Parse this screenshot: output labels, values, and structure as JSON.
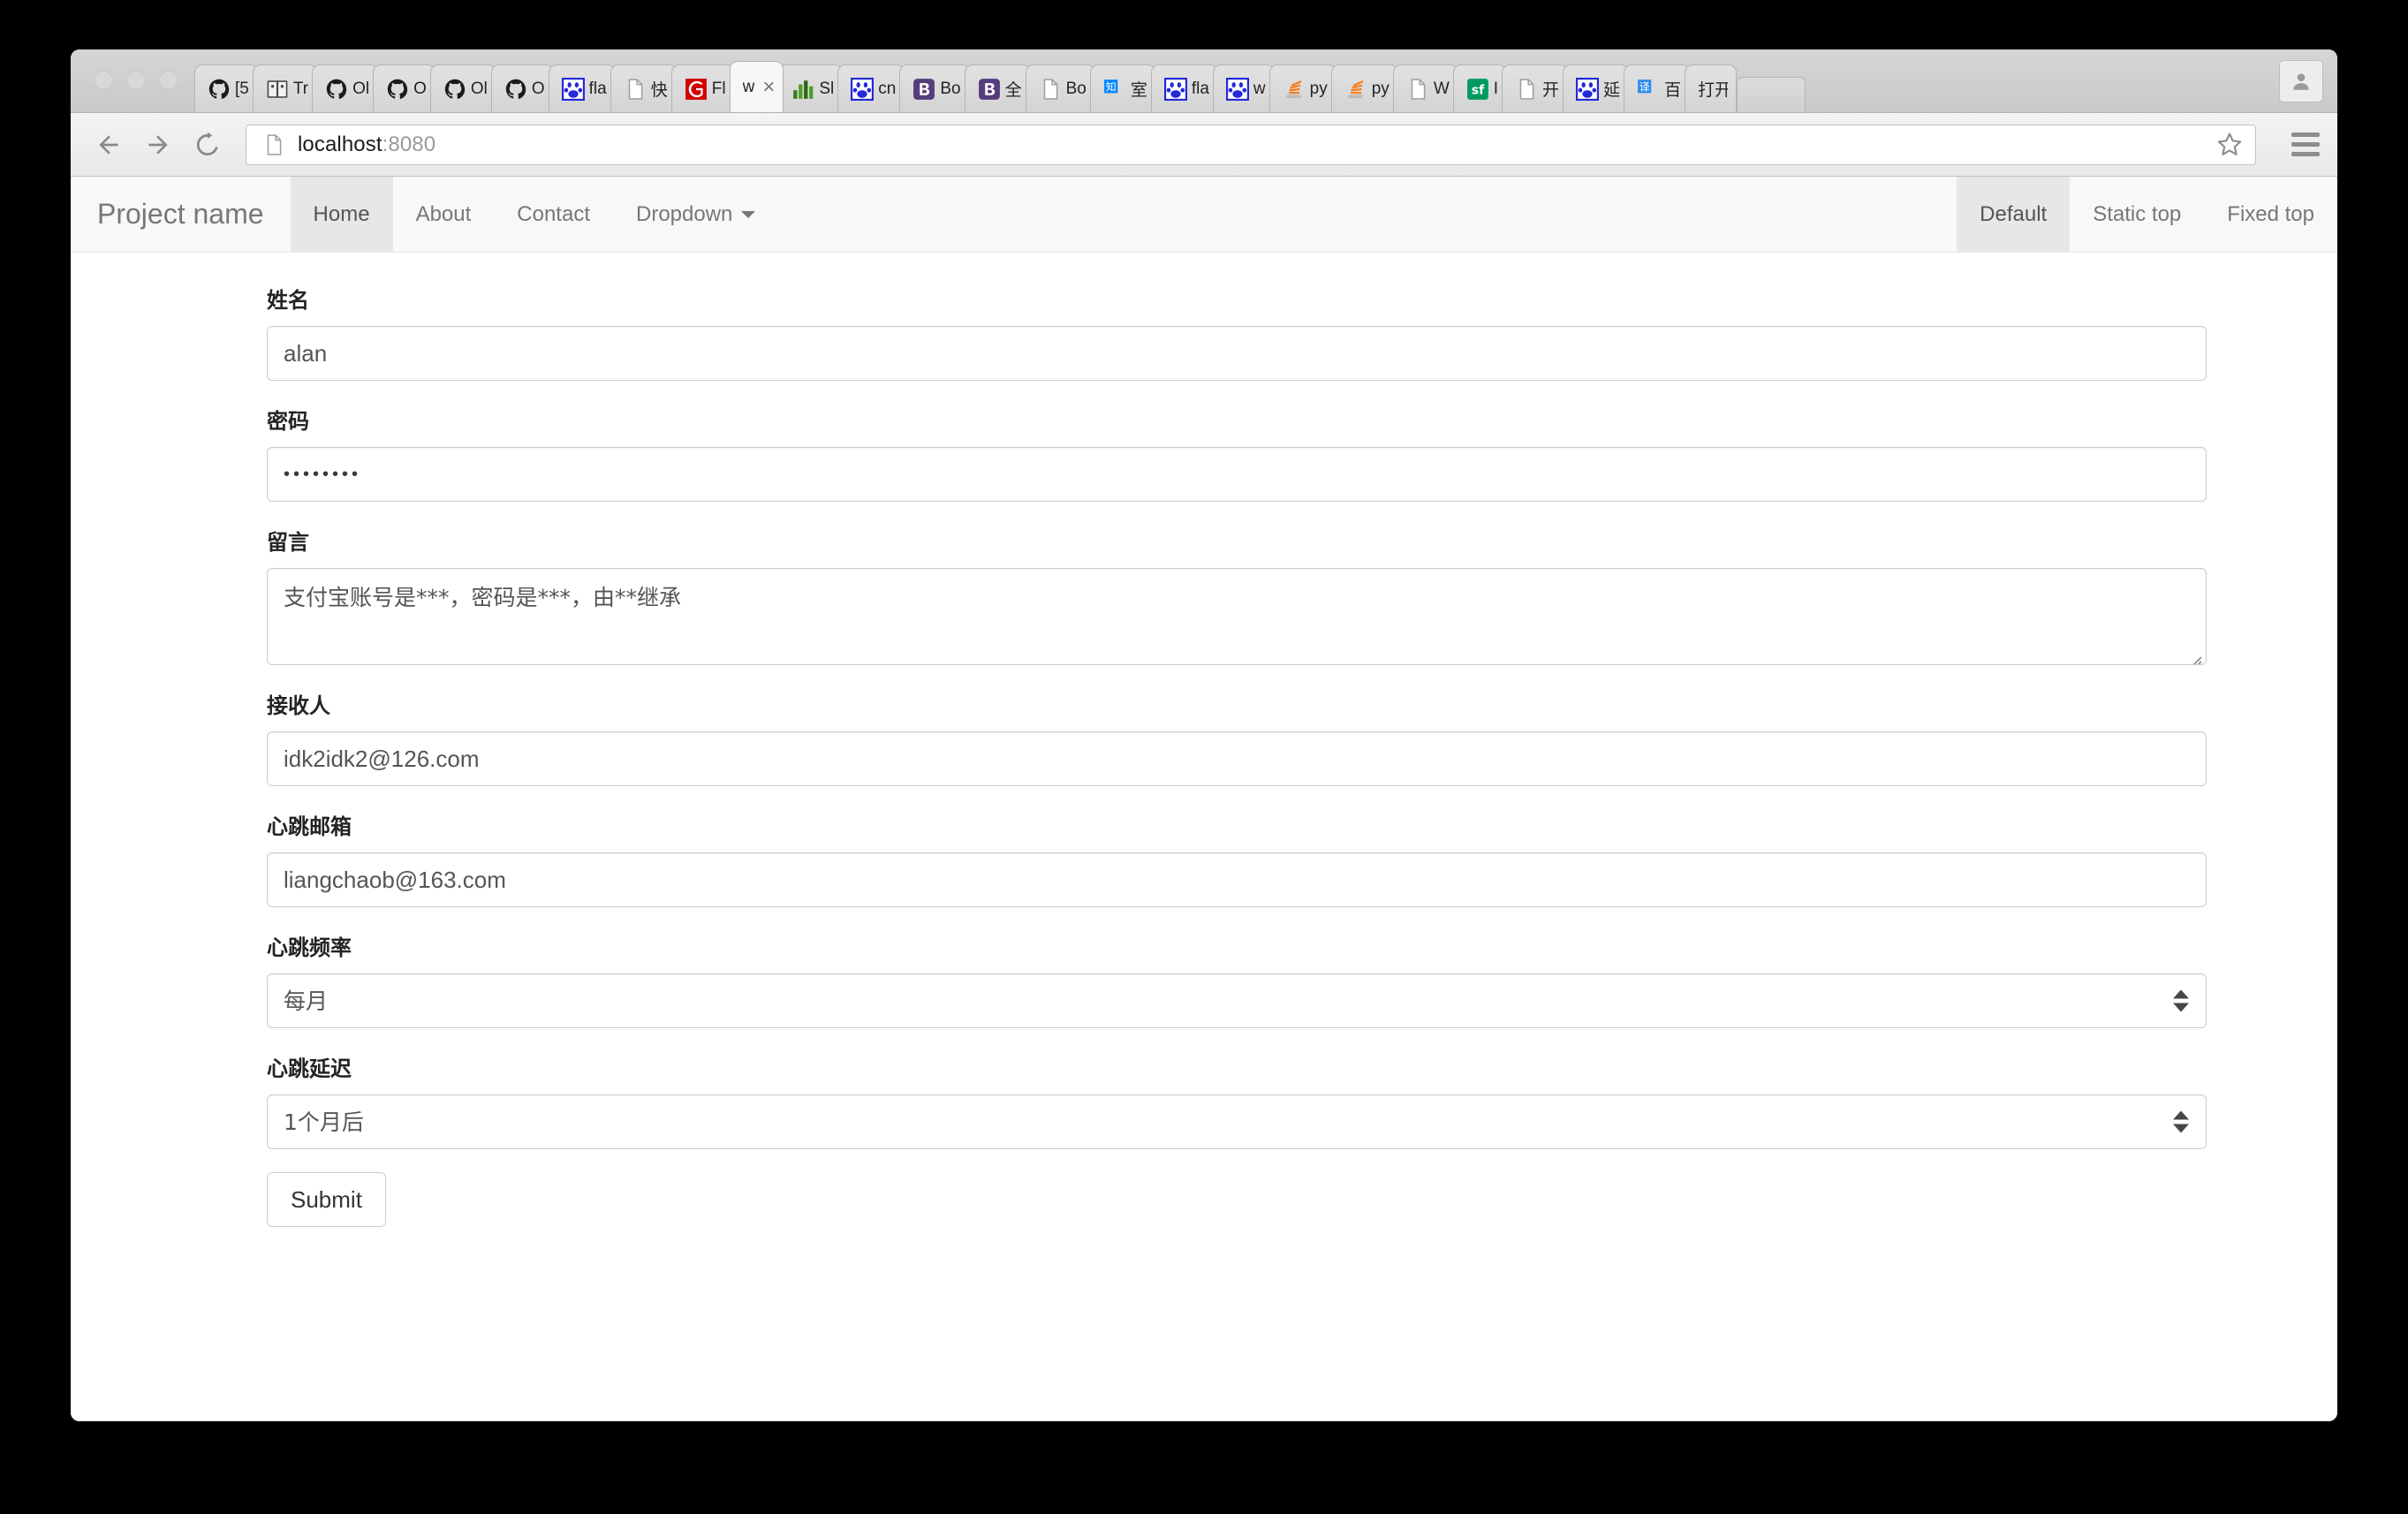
{
  "browser": {
    "traffic_lights": [
      "close",
      "minimize",
      "zoom"
    ],
    "tabs": [
      {
        "icon": "github-icon",
        "title": "[5"
      },
      {
        "icon": "book-icon",
        "title": "Tr"
      },
      {
        "icon": "github-icon",
        "title": "Ol"
      },
      {
        "icon": "github-icon",
        "title": "O"
      },
      {
        "icon": "github-icon",
        "title": "Ol"
      },
      {
        "icon": "github-icon",
        "title": "O"
      },
      {
        "icon": "baidu-paw-icon",
        "title": "fla"
      },
      {
        "icon": "page-icon",
        "title": "快"
      },
      {
        "icon": "c-red-icon",
        "title": "Fl"
      },
      {
        "icon": "none",
        "title": "w",
        "active": true,
        "close": "×"
      },
      {
        "icon": "bars-green-icon",
        "title": "Sl"
      },
      {
        "icon": "baidu-paw-icon",
        "title": "cn"
      },
      {
        "icon": "bootstrap-icon",
        "title": "Bo"
      },
      {
        "icon": "bootstrap-icon",
        "title": "全"
      },
      {
        "icon": "page-icon",
        "title": "Bo"
      },
      {
        "icon": "zhihu-icon",
        "title": "室"
      },
      {
        "icon": "baidu-paw-icon",
        "title": "fla"
      },
      {
        "icon": "baidu-paw-icon",
        "title": "w"
      },
      {
        "icon": "stackoverflow-icon",
        "title": "py"
      },
      {
        "icon": "stackoverflow-icon",
        "title": "py"
      },
      {
        "icon": "page-icon",
        "title": "W"
      },
      {
        "icon": "segmentfault-icon",
        "title": "I"
      },
      {
        "icon": "page-icon",
        "title": "开"
      },
      {
        "icon": "baidu-paw-icon",
        "title": "延"
      },
      {
        "icon": "translate-icon",
        "title": "百"
      },
      {
        "icon": "none",
        "title": "打开新"
      }
    ],
    "toolbar": {
      "back_icon": "back-arrow-icon",
      "forward_icon": "forward-arrow-icon",
      "reload_icon": "reload-icon",
      "page_icon": "page-icon",
      "url_path": "localhost",
      "url_port": ":8080",
      "bookmark_icon": "star-icon",
      "menu_icon": "hamburger-menu-icon",
      "profile_icon": "profile-avatar-icon"
    }
  },
  "navbar": {
    "brand": "Project name",
    "left_items": [
      {
        "label": "Home",
        "active": true
      },
      {
        "label": "About",
        "active": false
      },
      {
        "label": "Contact",
        "active": false
      },
      {
        "label": "Dropdown",
        "active": false,
        "caret": true
      }
    ],
    "right_items": [
      {
        "label": "Default",
        "active": true
      },
      {
        "label": "Static top",
        "active": false
      },
      {
        "label": "Fixed top",
        "active": false
      }
    ]
  },
  "form": {
    "fields": [
      {
        "label": "姓名",
        "value": "alan",
        "type": "text"
      },
      {
        "label": "密码",
        "value": "••••••••",
        "type": "password"
      },
      {
        "label": "留言",
        "value": "支付宝账号是***，密码是***，由**继承",
        "type": "textarea"
      },
      {
        "label": "接收人",
        "value": "idk2idk2@126.com",
        "type": "email"
      },
      {
        "label": "心跳邮箱",
        "value": "liangchaob@163.com",
        "type": "email"
      },
      {
        "label": "心跳频率",
        "value": "每月",
        "type": "select"
      },
      {
        "label": "心跳延迟",
        "value": "1个月后",
        "type": "select"
      }
    ],
    "submit_label": "Submit"
  },
  "colors": {
    "navbar_bg": "#f8f8f8",
    "navbar_active_bg": "#e7e7e7",
    "text_muted": "#777777",
    "border": "#cccccc",
    "baidu_blue": "#2529d8",
    "bootstrap_purple": "#563d7c",
    "segmentfault_green": "#009a61",
    "zhihu_blue": "#0084ff",
    "translate_blue": "#2f8ced",
    "c_red": "#d30000",
    "so_orange": "#f48024"
  }
}
